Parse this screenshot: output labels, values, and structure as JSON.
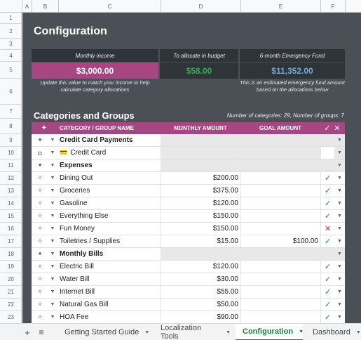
{
  "columns": [
    "A",
    "B",
    "C",
    "D",
    "E",
    "F"
  ],
  "rows": [
    "1",
    "2",
    "3",
    "4",
    "5",
    "6",
    "7",
    "8",
    "9",
    "10",
    "11",
    "12",
    "13",
    "14",
    "15",
    "16",
    "17",
    "18",
    "19",
    "20",
    "21",
    "22",
    "23"
  ],
  "title": "Configuration",
  "cards": {
    "income_label": "Monthly income",
    "income_value": "$3,000.00",
    "income_note": "Update this value to match your income to help calculate category allocations",
    "allocate_label": "To allocate in budget",
    "allocate_value": "$58.00",
    "emergency_label": "6-month Emergency Fund",
    "emergency_value": "$11,352.00",
    "emergency_note": "This is an estimated emergency fund amount based on the allocations below"
  },
  "section_title": "Categories and Groups",
  "counts": "Number of categories: 29, Number of groups: 7",
  "table_header": {
    "handle_icon": "✦",
    "name": "CATEGORY / GROUP NAME",
    "monthly": "MONTHLY AMOUNT",
    "goal": "GOAL AMOUNT",
    "check": "✓",
    "x": "✕"
  },
  "table_rows": [
    {
      "type": "group",
      "handle": "✦",
      "name": "Credit Card Payments",
      "monthly": "",
      "goal": "",
      "check": ""
    },
    {
      "type": "card",
      "handle": "◘",
      "icon": "💳",
      "name": "Credit Card",
      "monthly": "",
      "goal": "",
      "check": ""
    },
    {
      "type": "group",
      "handle": "✦",
      "name": "Expenses",
      "monthly": "",
      "goal": "",
      "check": ""
    },
    {
      "type": "item",
      "handle": "✧",
      "name": "Dining Out",
      "monthly": "$200.00",
      "goal": "",
      "check": "✓"
    },
    {
      "type": "item",
      "handle": "✧",
      "name": "Groceries",
      "monthly": "$375.00",
      "goal": "",
      "check": "✓"
    },
    {
      "type": "item",
      "handle": "✧",
      "name": "Gasoline",
      "monthly": "$120.00",
      "goal": "",
      "check": "✓"
    },
    {
      "type": "item",
      "handle": "✧",
      "name": "Everything Else",
      "monthly": "$150.00",
      "goal": "",
      "check": "✓"
    },
    {
      "type": "item",
      "handle": "✧",
      "name": "Fun Money",
      "monthly": "$150.00",
      "goal": "",
      "check": "✕"
    },
    {
      "type": "item",
      "handle": "✧",
      "name": "Toiletries / Supplies",
      "monthly": "$15.00",
      "goal": "$100.00",
      "check": "✓"
    },
    {
      "type": "group",
      "handle": "✦",
      "name": "Monthly Bills",
      "monthly": "",
      "goal": "",
      "check": ""
    },
    {
      "type": "item",
      "handle": "✧",
      "name": "Electric Bill",
      "monthly": "$120.00",
      "goal": "",
      "check": "✓"
    },
    {
      "type": "item",
      "handle": "✧",
      "name": "Water Bill",
      "monthly": "$30.00",
      "goal": "",
      "check": "✓"
    },
    {
      "type": "item",
      "handle": "✧",
      "name": "Internet Bill",
      "monthly": "$55.00",
      "goal": "",
      "check": "✓"
    },
    {
      "type": "item",
      "handle": "✧",
      "name": "Natural Gas Bill",
      "monthly": "$50.00",
      "goal": "",
      "check": "✓"
    },
    {
      "type": "item",
      "handle": "✧",
      "name": "HOA Fee",
      "monthly": "$90.00",
      "goal": "",
      "check": "✓"
    }
  ],
  "tabs": {
    "add": "+",
    "list": "≡",
    "sheets": [
      {
        "label": "Getting Started Guide",
        "active": false
      },
      {
        "label": "Localization Tools",
        "active": false
      },
      {
        "label": "Configuration",
        "active": true
      },
      {
        "label": "Dashboard",
        "active": false
      }
    ]
  },
  "colors": {
    "accent": "#a84684",
    "card_bg": "#2f3438",
    "panel_bg": "#4a5055",
    "income_value_bg": "#a84684",
    "allocate_value_text": "#34a853",
    "emergency_value_text": "#6fa8dc",
    "ok": "#1e8e3e",
    "bad": "#d93025"
  }
}
